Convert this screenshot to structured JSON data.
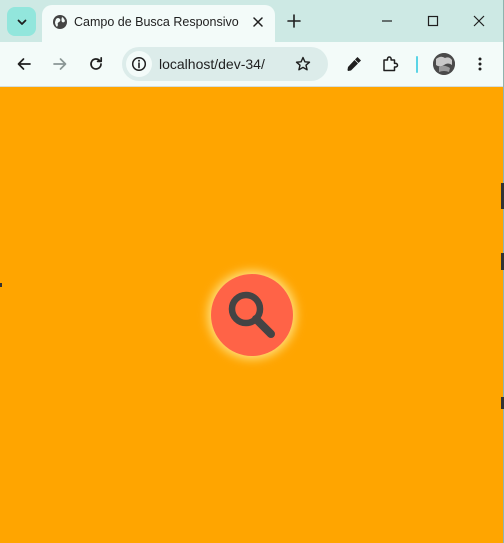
{
  "browser": {
    "tab": {
      "title": "Campo de Busca Responsivo",
      "favicon": "globe-icon"
    },
    "address_bar": {
      "url": "localhost/dev-34/"
    },
    "toolbar_icons": [
      "back-icon",
      "forward-icon",
      "reload-icon",
      "info-icon",
      "star-icon",
      "eyedropper-icon",
      "extensions-icon",
      "avatar",
      "more-icon"
    ],
    "window_controls": [
      "minimize-icon",
      "maximize-icon",
      "close-icon"
    ]
  },
  "page": {
    "background_color": "#ffa500",
    "search_button": {
      "icon": "search-icon",
      "color": "#ff6347"
    }
  }
}
